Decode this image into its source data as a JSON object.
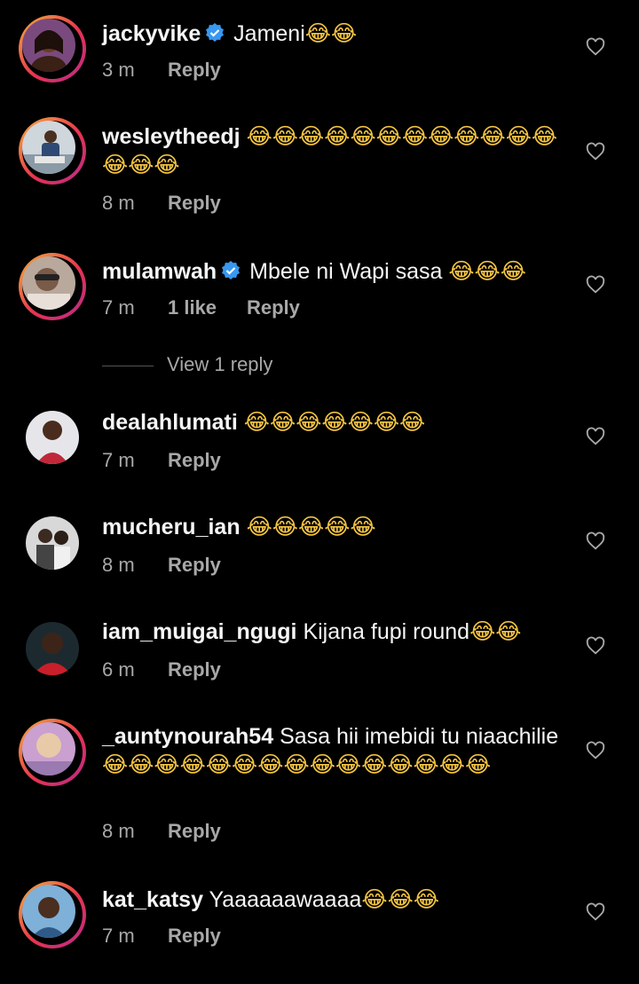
{
  "comments": [
    {
      "username": "jackyvike",
      "verified": true,
      "text": "Jameni",
      "emoji": "😂😂",
      "time": "3 m",
      "likes": "",
      "reply": "Reply"
    },
    {
      "username": "wesleytheedj",
      "verified": false,
      "text": "",
      "emoji": "😂😂😂😂😂😂😂😂😂😂😂😂😂😂😂",
      "time": "8 m",
      "likes": "",
      "reply": "Reply"
    },
    {
      "username": "mulamwah",
      "verified": true,
      "text": "Mbele ni Wapi sasa",
      "emoji": "😂😂😂",
      "time": "7 m",
      "likes": "1 like",
      "reply": "Reply"
    },
    {
      "username": "dealahlumati",
      "verified": false,
      "text": "",
      "emoji": "😂😂😂😂😂😂😂",
      "time": "7 m",
      "likes": "",
      "reply": "Reply"
    },
    {
      "username": "mucheru_ian",
      "verified": false,
      "text": "",
      "emoji": "😂😂😂😂😂",
      "time": "8 m",
      "likes": "",
      "reply": "Reply"
    },
    {
      "username": "iam_muigai_ngugi",
      "verified": false,
      "text": "Kijana fupi round",
      "emoji": "😂😂",
      "time": "6 m",
      "likes": "",
      "reply": "Reply"
    },
    {
      "username": "_auntynourah54",
      "verified": false,
      "text": "Sasa hii imebidi tu niaachilie",
      "emoji": "😂😂😂😂😂😂😂😂😂😂😂😂😂😂😂",
      "time": "8 m",
      "likes": "",
      "reply": "Reply"
    },
    {
      "username": "kat_katsy",
      "verified": false,
      "text": "Yaaaaaawaaaa",
      "emoji": "😂😂😂",
      "time": "7 m",
      "likes": "",
      "reply": "Reply"
    }
  ],
  "view_replies": "View 1 reply",
  "colors": {
    "background": "#000000",
    "meta": "#a8a8a8",
    "verified": "#3897f0",
    "ring": "#e8344e"
  }
}
